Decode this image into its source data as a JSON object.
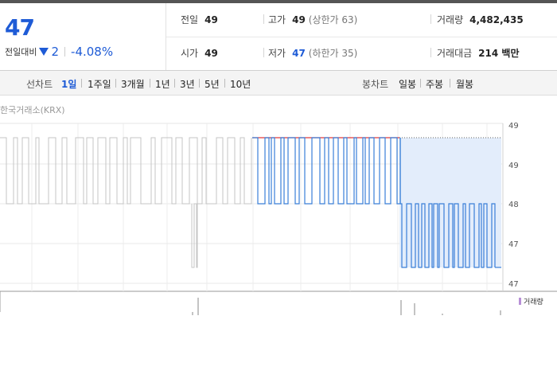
{
  "quote": {
    "price": "47",
    "change_label": "전일대비",
    "change_amount": "2",
    "change_pct": "-4.08%"
  },
  "info": {
    "prev_close": {
      "label": "전일",
      "value": "49"
    },
    "high": {
      "label": "고가",
      "value": "49",
      "sub": "(상한가 63)"
    },
    "volume": {
      "label": "거래량",
      "value": "4,482,435"
    },
    "open": {
      "label": "시가",
      "value": "49"
    },
    "low": {
      "label": "저가",
      "value": "47",
      "sub": "(하한가 35)"
    },
    "amount": {
      "label": "거래대금",
      "value": "214 백만"
    }
  },
  "toolbar": {
    "line_label": "선차트",
    "periods": [
      "1일",
      "1주일",
      "3개월",
      "1년",
      "3년",
      "5년",
      "10년"
    ],
    "selected_period": "1일",
    "candle_label": "봉차트",
    "candles": [
      "일봉",
      "주봉",
      "월봉"
    ]
  },
  "chart_data": {
    "type": "line",
    "source": "한국거래소(KRX)",
    "y_ticks": [
      "49",
      "49",
      "48",
      "47",
      "47"
    ],
    "ylim": [
      47,
      49
    ],
    "legend": "거래량",
    "colors": {
      "gray": "#c4c4c4",
      "blue": "#3a7fd8",
      "red": "#e23a3a",
      "fill": "#e3edfb",
      "volume": "#b78fd6"
    }
  }
}
